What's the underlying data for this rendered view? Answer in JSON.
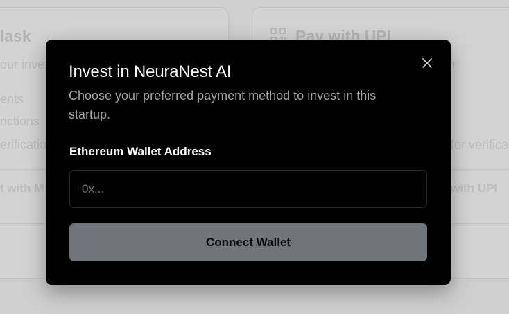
{
  "background": {
    "left_card": {
      "title": "lask",
      "subtitle": "our inve",
      "items": [
        "ents",
        "nctions",
        "erificatio"
      ],
      "button_label": "t with M"
    },
    "right_card": {
      "title": "Pay with UPI",
      "subtitle": "n",
      "item_text": "for verifica",
      "button_label": "with UPI",
      "icon": "qr-code-icon"
    }
  },
  "modal": {
    "title": "Invest in NeuraNest AI",
    "description": "Choose your preferred payment method to invest in this startup.",
    "close_icon": "close-icon",
    "wallet_field": {
      "label": "Ethereum Wallet Address",
      "value": "",
      "placeholder": "0x..."
    },
    "connect_button_label": "Connect Wallet"
  },
  "colors": {
    "modal_bg": "#000000",
    "button_bg": "#71747b",
    "page_bg": "#cfcfcf"
  }
}
